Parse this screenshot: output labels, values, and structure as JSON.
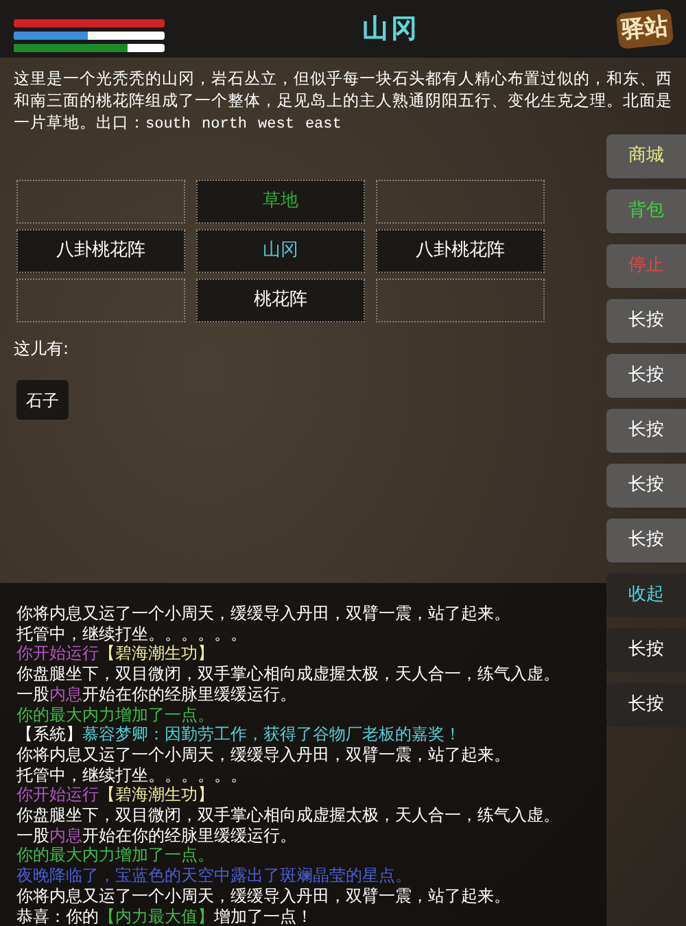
{
  "header": {
    "title": "山冈",
    "logo": "驿站",
    "bars": [
      {
        "color": "#d42020",
        "level": 1
      },
      {
        "color": "#3a8fd8",
        "level": 0.49
      },
      {
        "color": "#1d8a2a",
        "level": 0.75
      }
    ]
  },
  "description": {
    "text": "这里是一个光秃秃的山冈，岩石丛立，但似乎每一块石头都有人精心布置过似的，和东、西和南三面的桃花阵组成了一个整体，足见岛上的主人熟通阴阳五行、变化生克之理。北面是一片草地。出口：",
    "exits": [
      "south",
      "north",
      "west",
      "east"
    ]
  },
  "map": [
    {
      "kind": "empty"
    },
    {
      "kind": "room",
      "label": "草地",
      "color": "#2fae3a"
    },
    {
      "kind": "empty"
    },
    {
      "kind": "room",
      "label": "八卦桃花阵",
      "color": "#ffffff"
    },
    {
      "kind": "room",
      "label": "山冈",
      "color": "#59c3d6"
    },
    {
      "kind": "room",
      "label": "八卦桃花阵",
      "color": "#ffffff"
    },
    {
      "kind": "empty"
    },
    {
      "kind": "room",
      "label": "桃花阵",
      "color": "#ffffff"
    },
    {
      "kind": "empty"
    }
  ],
  "items_heading": "这儿有:",
  "items": [
    "石子"
  ],
  "side_buttons": [
    {
      "label": "商城",
      "color": "#e6e68a",
      "faded": false
    },
    {
      "label": "背包",
      "color": "#3ed14a",
      "faded": false
    },
    {
      "label": "停止",
      "color": "#e04848",
      "faded": false
    },
    {
      "label": "长按",
      "color": "#ffffff",
      "faded": false
    },
    {
      "label": "长按",
      "color": "#ffffff",
      "faded": false
    },
    {
      "label": "长按",
      "color": "#ffffff",
      "faded": false
    },
    {
      "label": "长按",
      "color": "#ffffff",
      "faded": false
    },
    {
      "label": "长按",
      "color": "#ffffff",
      "faded": false
    },
    {
      "label": "收起",
      "color": "#4fd6e0",
      "faded": true
    },
    {
      "label": "长按",
      "color": "#ffffff",
      "faded": true
    },
    {
      "label": "长按",
      "color": "#ffffff",
      "faded": true
    }
  ],
  "log": [
    [
      {
        "text": "你将内息又运了一个小周天，缓缓导入丹田，双臂一震，站了起来。",
        "color": "#ffffff"
      }
    ],
    [
      {
        "text": "托管中，继续打坐。。。。。。",
        "color": "#ffffff"
      }
    ],
    [
      {
        "text": "你开始运行",
        "color": "#b457c8"
      },
      {
        "text": "【碧海潮生功】",
        "color": "#f0ee9a"
      }
    ],
    [
      {
        "text": "你盘腿坐下，双目微闭，双手掌心相向成虚握太极，天人合一，练气入虚。",
        "color": "#ffffff"
      }
    ],
    [
      {
        "text": "一股",
        "color": "#ffffff"
      },
      {
        "text": "内息",
        "color": "#b457c8"
      },
      {
        "text": "开始在你的经脉里缓缓运行。",
        "color": "#ffffff"
      }
    ],
    [
      {
        "text": "你的最大内力增加了一点。",
        "color": "#3cc04a"
      }
    ],
    [
      {
        "text": "【系統】",
        "color": "#ffffff"
      },
      {
        "text": "慕容梦卿：因勤劳工作，获得了谷物厂老板的嘉奖！",
        "color": "#55d0d8"
      }
    ],
    [
      {
        "text": "你将内息又运了一个小周天，缓缓导入丹田，双臂一震，站了起来。",
        "color": "#ffffff"
      }
    ],
    [
      {
        "text": "托管中，继续打坐。。。。。。",
        "color": "#ffffff"
      }
    ],
    [
      {
        "text": "你开始运行",
        "color": "#b457c8"
      },
      {
        "text": "【碧海潮生功】",
        "color": "#f0ee9a"
      }
    ],
    [
      {
        "text": "你盘腿坐下，双目微闭，双手掌心相向成虚握太极，天人合一，练气入虚。",
        "color": "#ffffff"
      }
    ],
    [
      {
        "text": "一股",
        "color": "#ffffff"
      },
      {
        "text": "内息",
        "color": "#b457c8"
      },
      {
        "text": "开始在你的经脉里缓缓运行。",
        "color": "#ffffff"
      }
    ],
    [
      {
        "text": "你的最大内力增加了一点。",
        "color": "#3cc04a"
      }
    ],
    [
      {
        "text": "夜晚降临了，宝蓝色的天空中露出了斑斓晶莹的星点。",
        "color": "#4b5fd8"
      }
    ],
    [
      {
        "text": "你将内息又运了一个小周天，缓缓导入丹田，双臂一震，站了起来。",
        "color": "#ffffff"
      }
    ],
    [
      {
        "text": "恭喜：你的",
        "color": "#ffffff"
      },
      {
        "text": "【内力最大值】",
        "color": "#3cc04a"
      },
      {
        "text": "增加了一点！",
        "color": "#ffffff"
      }
    ]
  ]
}
